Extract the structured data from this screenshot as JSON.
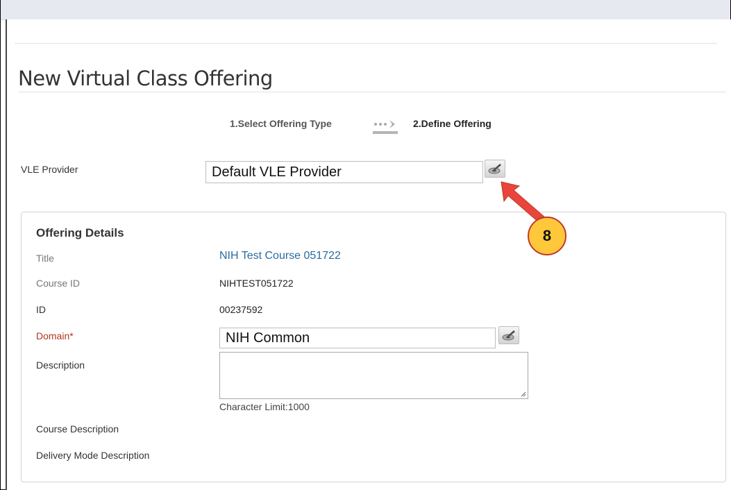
{
  "page": {
    "title": "New Virtual Class Offering"
  },
  "wizard": {
    "steps": [
      {
        "label": "1.Select Offering Type"
      },
      {
        "label": "2.Define Offering"
      }
    ]
  },
  "vle": {
    "label": "VLE Provider",
    "value": "Default VLE Provider"
  },
  "offering_details": {
    "heading": "Offering Details",
    "fields": {
      "title": {
        "label": "Title",
        "value": "NIH Test Course 051722"
      },
      "course_id": {
        "label": "Course ID",
        "value": "NIHTEST051722"
      },
      "id": {
        "label": "ID",
        "value": "00237592"
      },
      "domain": {
        "label": "Domain*",
        "value": "NIH Common"
      },
      "description": {
        "label": "Description",
        "value": "",
        "char_limit": "Character Limit:1000"
      },
      "course_description": {
        "label": "Course Description"
      },
      "delivery_mode_description": {
        "label": "Delivery Mode Description"
      }
    }
  },
  "annotation": {
    "badge": "8"
  },
  "colors": {
    "required": "#b1361e",
    "link": "#2a6a9e",
    "badge_fill": "#ffc83a",
    "arrow": "#e8453c"
  },
  "icons": {
    "edit": "edit-pencil-icon",
    "step_arrow": "step-arrow-icon"
  }
}
